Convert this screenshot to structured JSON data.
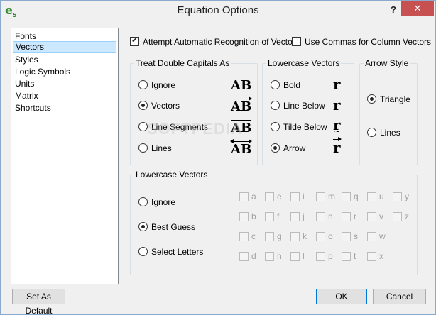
{
  "window": {
    "title": "Equation Options",
    "help_label": "?",
    "close_label": "✕",
    "app_icon_letter": "e",
    "app_icon_sub": "5"
  },
  "nav": {
    "items": [
      "Fonts",
      "Vectors",
      "Styles",
      "Logic Symbols",
      "Units",
      "Matrix",
      "Shortcuts"
    ],
    "selected": "Vectors"
  },
  "top_options": {
    "auto_recognition_label": "Attempt Automatic Recognition of Vectors",
    "auto_recognition_checked": true,
    "commas_label": "Use Commas for Column Vectors",
    "commas_checked": false
  },
  "double_capitals": {
    "title": "Treat Double Capitals As",
    "options": [
      {
        "label": "Ignore",
        "checked": false,
        "symbol": "AB"
      },
      {
        "label": "Vectors",
        "checked": true,
        "symbol": "AB"
      },
      {
        "label": "Line Segments",
        "checked": false,
        "symbol": "AB"
      },
      {
        "label": "Lines",
        "checked": false,
        "symbol": "AB"
      }
    ]
  },
  "lowercase_vectors_top": {
    "title": "Lowercase Vectors",
    "options": [
      {
        "label": "Bold",
        "checked": false,
        "symbol": "r"
      },
      {
        "label": "Line Below",
        "checked": false,
        "symbol": "r"
      },
      {
        "label": "Tilde Below",
        "checked": false,
        "symbol": "r"
      },
      {
        "label": "Arrow",
        "checked": true,
        "symbol": "r"
      }
    ]
  },
  "arrow_style": {
    "title": "Arrow Style",
    "options": [
      {
        "label": "Triangle",
        "checked": true
      },
      {
        "label": "Lines",
        "checked": false
      }
    ]
  },
  "lowercase_vectors_bottom": {
    "title": "Lowercase Vectors",
    "options": [
      {
        "label": "Ignore",
        "checked": false
      },
      {
        "label": "Best Guess",
        "checked": true
      },
      {
        "label": "Select Letters",
        "checked": false
      }
    ],
    "letter_rows": [
      [
        "a",
        "e",
        "i",
        "m",
        "q",
        "u",
        "y"
      ],
      [
        "b",
        "f",
        "j",
        "n",
        "r",
        "v",
        "z"
      ],
      [
        "c",
        "g",
        "k",
        "o",
        "s",
        "w"
      ],
      [
        "d",
        "h",
        "l",
        "p",
        "t",
        "x"
      ]
    ]
  },
  "buttons": {
    "set_default": "Set As Default",
    "ok": "OK",
    "cancel": "Cancel"
  },
  "watermark": "SOFTPEDIA"
}
